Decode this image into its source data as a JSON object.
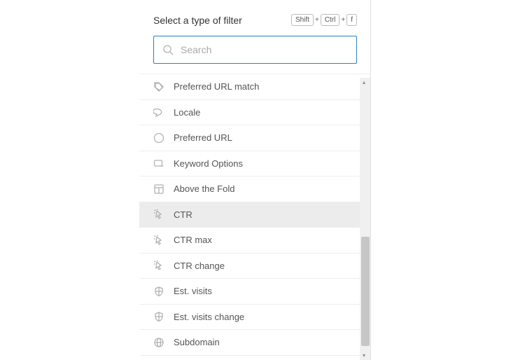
{
  "header": {
    "title": "Select a type of filter",
    "shortcut": {
      "k1": "Shift",
      "k2": "Ctrl",
      "k3": "f"
    }
  },
  "search": {
    "placeholder": "Search",
    "value": ""
  },
  "filters": [
    {
      "label": "Preferred URL match",
      "icon": "tag-icon",
      "hover": false
    },
    {
      "label": "Locale",
      "icon": "chat-icon",
      "hover": false
    },
    {
      "label": "Preferred URL",
      "icon": "question-icon",
      "hover": false
    },
    {
      "label": "Keyword Options",
      "icon": "options-icon",
      "hover": false
    },
    {
      "label": "Above the Fold",
      "icon": "layout-icon",
      "hover": false
    },
    {
      "label": "CTR",
      "icon": "cursor-icon",
      "hover": true
    },
    {
      "label": "CTR max",
      "icon": "cursor-icon",
      "hover": false
    },
    {
      "label": "CTR change",
      "icon": "cursor-icon",
      "hover": false
    },
    {
      "label": "Est. visits",
      "icon": "shield-icon",
      "hover": false
    },
    {
      "label": "Est. visits change",
      "icon": "shield-icon",
      "hover": false
    },
    {
      "label": "Subdomain",
      "icon": "globe-icon",
      "hover": false
    }
  ]
}
